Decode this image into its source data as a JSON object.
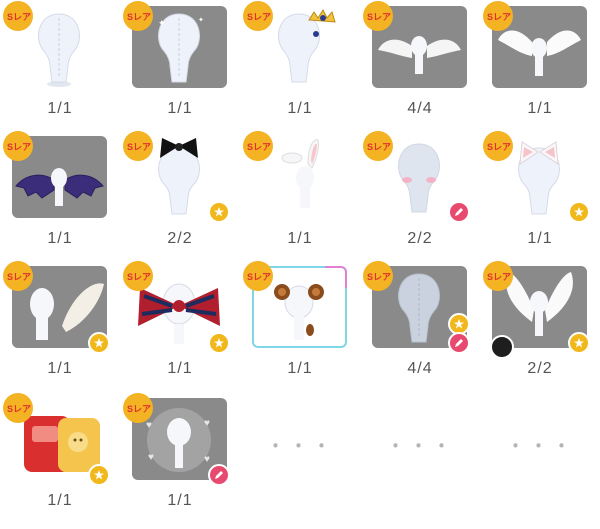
{
  "rarity_badge_text": "Sレア",
  "more_placeholder": "・・・",
  "items": [
    {
      "name": "body-base",
      "count": "1/1",
      "bg": "white",
      "sub": ""
    },
    {
      "name": "body-sparkle",
      "count": "1/1",
      "bg": "gray",
      "sub": ""
    },
    {
      "name": "tiara",
      "count": "1/1",
      "bg": "white",
      "sub": ""
    },
    {
      "name": "white-wings",
      "count": "4/4",
      "bg": "gray",
      "sub": ""
    },
    {
      "name": "feather-wings",
      "count": "1/1",
      "bg": "gray",
      "sub": ""
    },
    {
      "name": "bat-wings",
      "count": "1/1",
      "bg": "gray",
      "sub": ""
    },
    {
      "name": "black-bow",
      "count": "2/2",
      "bg": "white",
      "sub": "star"
    },
    {
      "name": "bunny-ears",
      "count": "1/1",
      "bg": "white",
      "sub": ""
    },
    {
      "name": "blush",
      "count": "2/2",
      "bg": "white",
      "sub": "pen"
    },
    {
      "name": "cat-ears",
      "count": "1/1",
      "bg": "white",
      "sub": "star"
    },
    {
      "name": "fluffy-tail",
      "count": "1/1",
      "bg": "gray",
      "sub": "star"
    },
    {
      "name": "plaid-ribbon",
      "count": "1/1",
      "bg": "white",
      "sub": "star"
    },
    {
      "name": "sheep-horns",
      "count": "1/1",
      "bg": "white",
      "sub": "",
      "selected": true
    },
    {
      "name": "sparkle-body",
      "count": "4/4",
      "bg": "gray",
      "sub": "star,pen"
    },
    {
      "name": "angel-wings",
      "count": "2/2",
      "bg": "gray",
      "sub": "star"
    },
    {
      "name": "school-backpack",
      "count": "1/1",
      "bg": "white",
      "sub": "star"
    },
    {
      "name": "heart-aura",
      "count": "1/1",
      "bg": "gray",
      "sub": "pen"
    }
  ],
  "colors": {
    "badge_gold": "#f3b323",
    "badge_red": "#e0322f",
    "star_badge": "#f1b81b",
    "pen_badge": "#e84a6f",
    "tile_gray": "#8a8a8a",
    "selected_border": "#7fd6e6"
  }
}
